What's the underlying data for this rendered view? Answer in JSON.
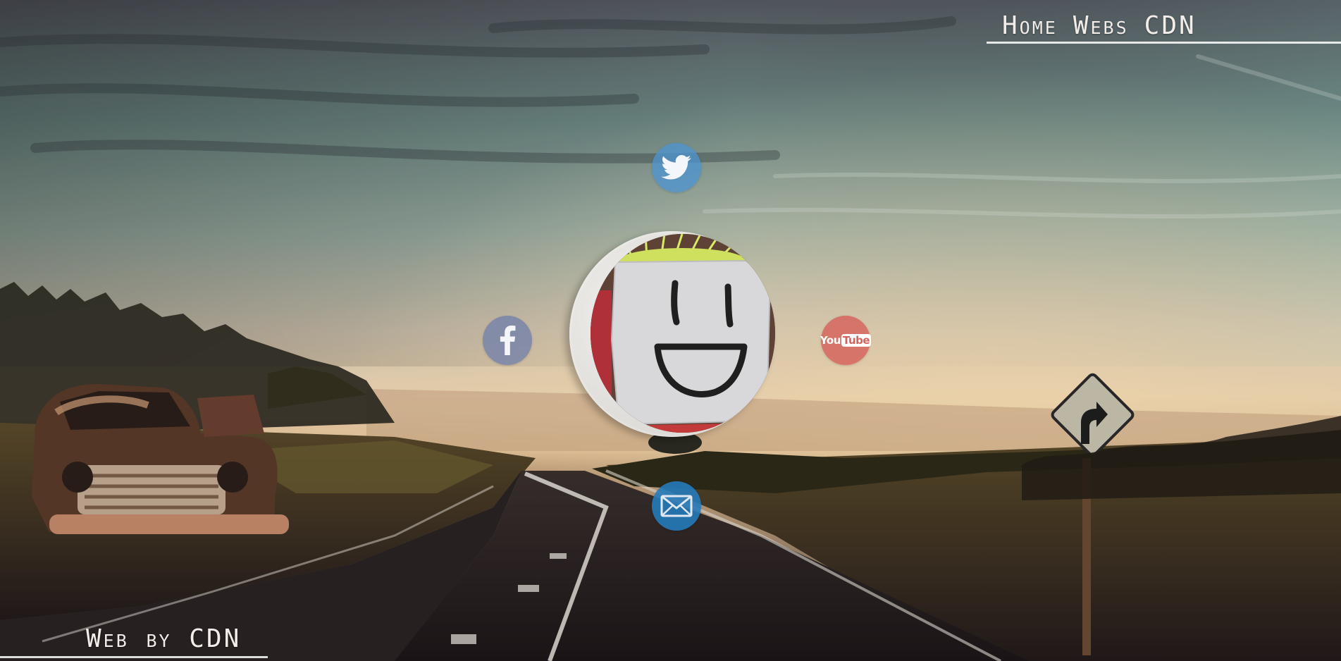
{
  "nav": {
    "links": [
      {
        "label": "Home"
      },
      {
        "label": "Webs"
      },
      {
        "label": "CDN"
      }
    ]
  },
  "footer": {
    "credit": "Web by CDN"
  },
  "social": {
    "twitter": {
      "icon": "twitter-bird-icon",
      "color": "#4e94ce"
    },
    "facebook": {
      "icon": "facebook-f-icon",
      "color": "#6e7eaa"
    },
    "youtube": {
      "icon": "youtube-logo-icon",
      "color": "#d6625c",
      "label_you": "You",
      "label_tube": "Tube"
    },
    "email": {
      "icon": "envelope-icon",
      "color": "#257bba"
    }
  },
  "avatar": {
    "icon": "smiley-face-avatar"
  },
  "colors": {
    "text": "#f2ede8",
    "sky_top": "#5a6d6e",
    "horizon": "#f3dcb7",
    "ground": "#2a1f1f"
  }
}
